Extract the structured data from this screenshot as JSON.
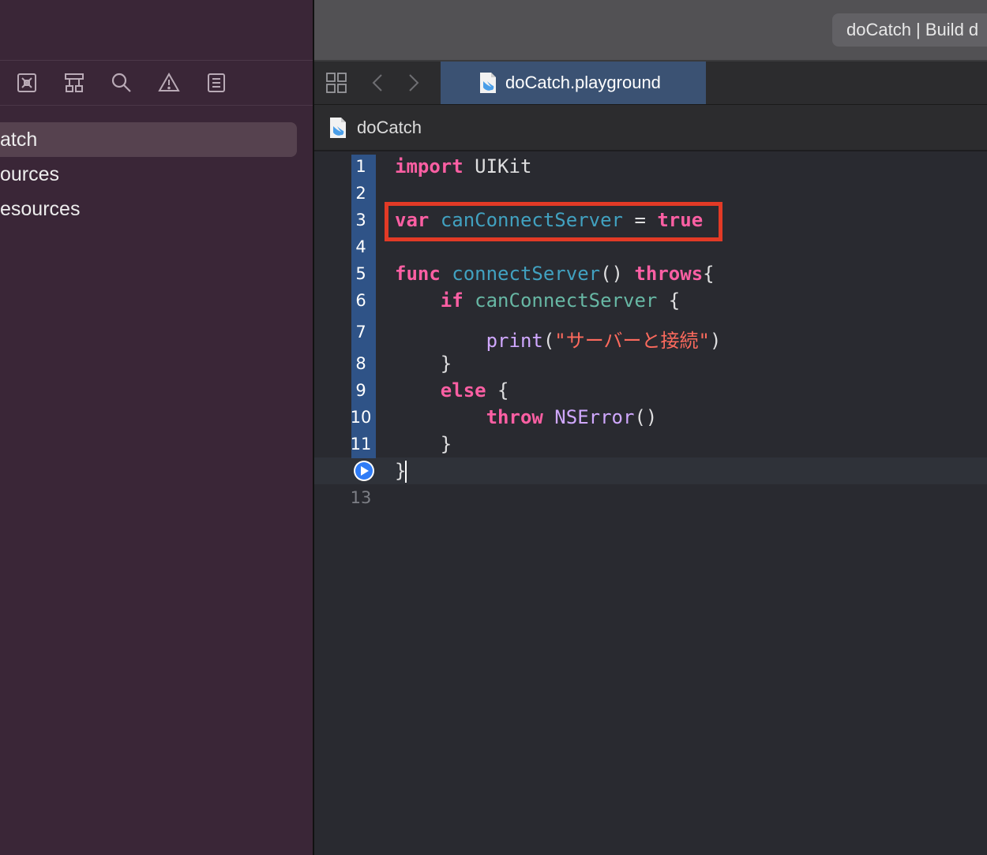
{
  "toolbar": {
    "status_text": "doCatch | Build d"
  },
  "navigator": {
    "tab_icons": [
      "files-icon",
      "hierarchy-icon",
      "search-icon",
      "issue-icon",
      "report-icon"
    ],
    "rows": [
      {
        "label": "atch",
        "selected": true
      },
      {
        "label": "ources",
        "selected": false
      },
      {
        "label": "esources",
        "selected": false
      }
    ]
  },
  "editor": {
    "tab_label": "doCatch.playground",
    "jump_label": "doCatch",
    "highlighted_lines": [
      1,
      11
    ],
    "run_line": 12,
    "lines": [
      {
        "n": "1",
        "text": "import UIKit"
      },
      {
        "n": "2",
        "text": ""
      },
      {
        "n": "3",
        "text": "var canConnectServer = true"
      },
      {
        "n": "4",
        "text": ""
      },
      {
        "n": "5",
        "text": "func connectServer() throws{"
      },
      {
        "n": "6",
        "text": "    if canConnectServer {"
      },
      {
        "n": "7",
        "text": "        print(\"サーバーと接続\")"
      },
      {
        "n": "8",
        "text": "    }"
      },
      {
        "n": "9",
        "text": "    else {"
      },
      {
        "n": "10",
        "text": "        throw NSError()"
      },
      {
        "n": "11",
        "text": "    }"
      },
      {
        "n": "12",
        "text": "}"
      },
      {
        "n": "13",
        "text": ""
      }
    ]
  }
}
